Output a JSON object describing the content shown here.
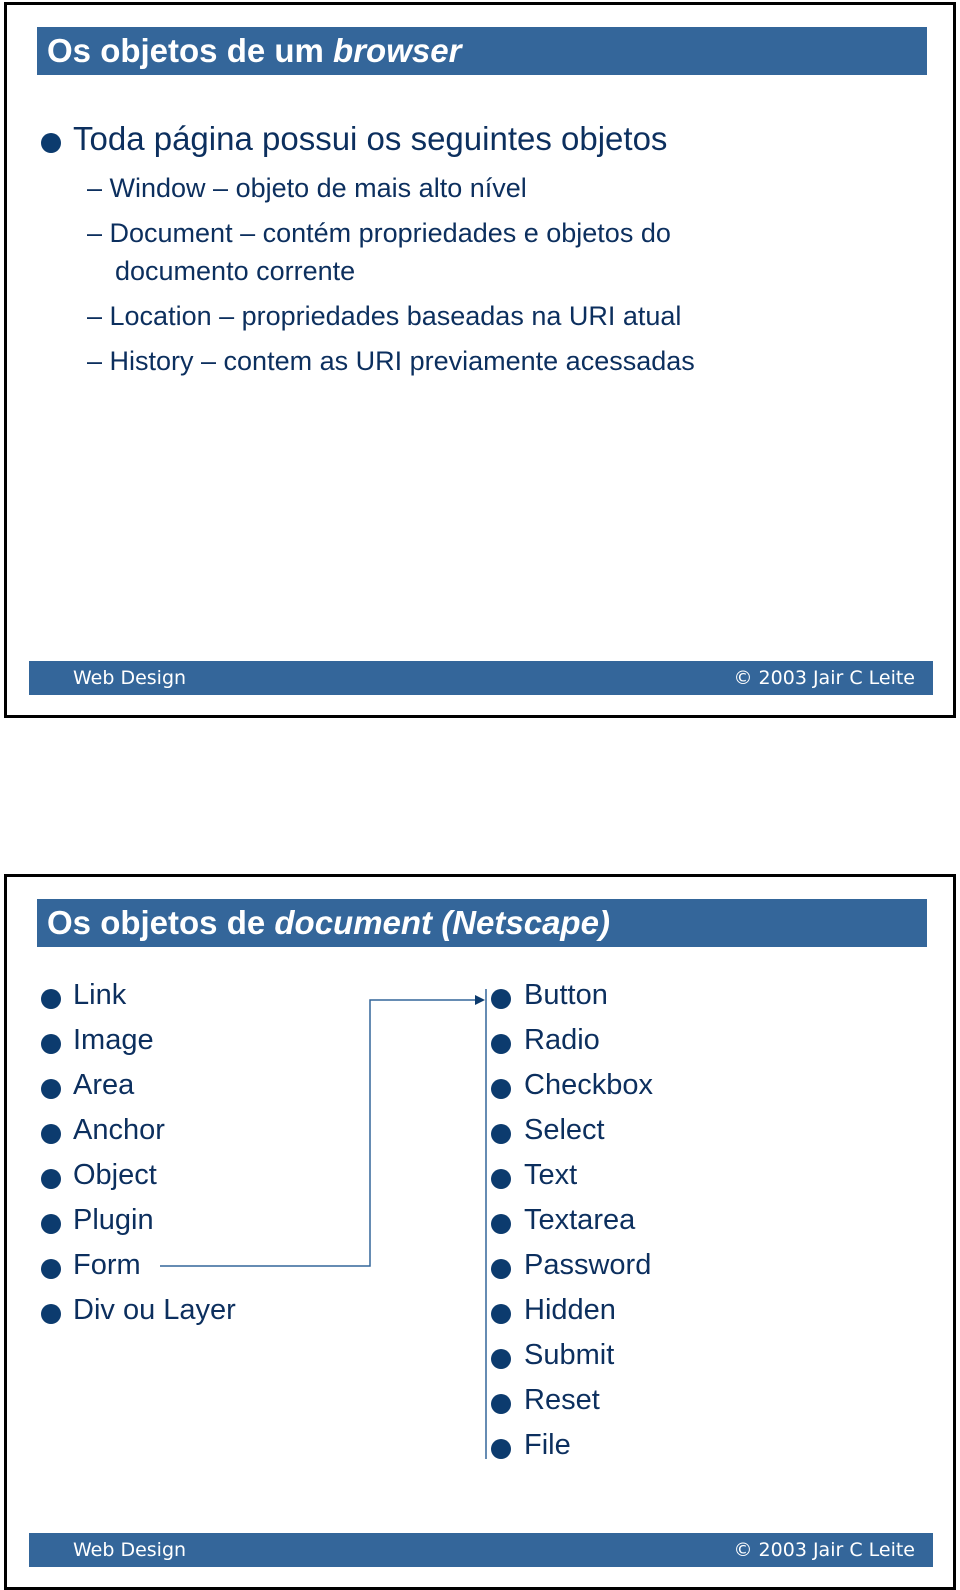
{
  "slide1": {
    "title_plain": "Os objetos de um ",
    "title_italic": "browser",
    "main_bullet": "Toda página possui os seguintes objetos",
    "sub_items": [
      "– Window – objeto de mais alto nível",
      "– Document – contém propriedades e objetos do",
      "documento corrente",
      "– Location – propriedades baseadas na URI atual",
      "– History – contem as URI previamente acessadas"
    ],
    "footer_left": "Web Design",
    "footer_right": "© 2003 Jair C Leite"
  },
  "slide2": {
    "title_plain": "Os objetos de ",
    "title_italic": "document (Netscape)",
    "left_items": [
      "Link",
      "Image",
      "Area",
      "Anchor",
      "Object",
      "Plugin",
      "Form",
      "Div ou Layer"
    ],
    "right_items": [
      "Button",
      "Radio",
      "Checkbox",
      "Select",
      "Text",
      "Textarea",
      "Password",
      "Hidden",
      "Submit",
      "Reset",
      "File"
    ],
    "footer_left": "Web Design",
    "footer_right": "© 2003 Jair C Leite"
  }
}
